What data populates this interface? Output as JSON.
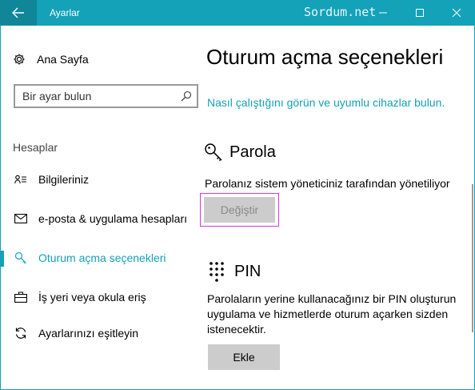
{
  "window": {
    "title": "Ayarlar",
    "watermark": "Sordum.net"
  },
  "sidebar": {
    "home_label": "Ana Sayfa",
    "search_placeholder": "Bir ayar bulun",
    "section_label": "Hesaplar",
    "items": [
      {
        "label": "Bilgileriniz",
        "icon": "person-card-icon",
        "active": false
      },
      {
        "label": "e-posta & uygulama hesapları",
        "icon": "mail-icon",
        "active": false
      },
      {
        "label": "Oturum açma seçenekleri",
        "icon": "key-icon",
        "active": true
      },
      {
        "label": "İş yeri veya okula eriş",
        "icon": "briefcase-icon",
        "active": false
      },
      {
        "label": "Ayarlarınızı eşitleyin",
        "icon": "sync-icon",
        "active": false
      }
    ]
  },
  "main": {
    "title": "Oturum açma seçenekleri",
    "link": "Nasıl çalıştığını görün ve uyumlu cihazlar bulun.",
    "password": {
      "heading": "Parola",
      "description": "Parolanız sistem yöneticiniz tarafından yönetiliyor",
      "button_label": "Değiştir",
      "button_state": "disabled"
    },
    "pin": {
      "heading": "PIN",
      "description_lines": [
        "Parolaların yerine kullanacağınız bir PIN oluşturun",
        "uygulama ve hizmetlerde oturum açarken sizden",
        "istenecektir."
      ],
      "button_label": "Ekle"
    }
  },
  "colors": {
    "accent": "#13a2b8",
    "highlight_border": "#d63ad6",
    "button_bg": "#cccccc"
  }
}
